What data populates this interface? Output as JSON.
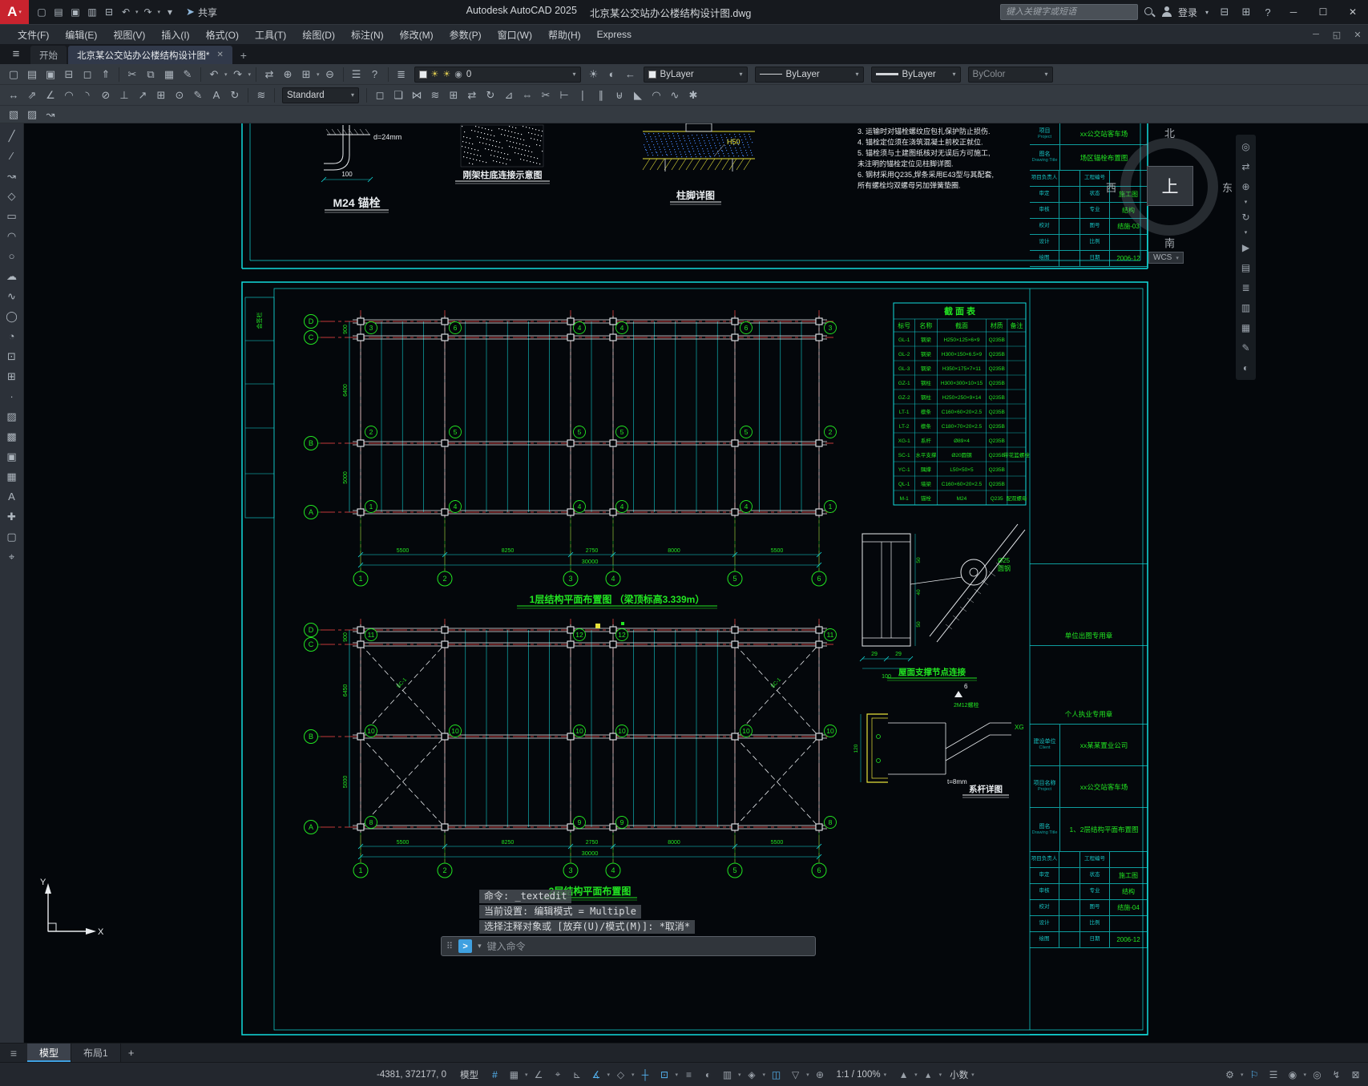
{
  "colors": {
    "accent": "#3fa0e0",
    "cad_cyan": "#12dcdc",
    "cad_red": "#c23a3a",
    "cad_green": "#22e522",
    "cad_yellow": "#e8e23a",
    "cad_white": "#e8ebee"
  },
  "titlebar": {
    "logo": "A",
    "share_label": "共享",
    "app_title": "Autodesk AutoCAD 2025",
    "doc_title": "北京某公交站办公楼结构设计图.dwg",
    "search_placeholder": "键入关键字或短语",
    "signin_label": "登录",
    "qat": [
      {
        "n": "qnew",
        "g": "▢"
      },
      {
        "n": "open",
        "g": "▤"
      },
      {
        "n": "save",
        "g": "▣"
      },
      {
        "n": "save-as",
        "g": "▥"
      },
      {
        "n": "plot",
        "g": "⊟"
      },
      {
        "n": "undo",
        "g": "↶",
        "dd": true
      },
      {
        "n": "redo",
        "g": "↷",
        "dd": true
      },
      {
        "n": "qat-customize",
        "g": "▾"
      }
    ]
  },
  "menubar": [
    "文件(F)",
    "编辑(E)",
    "视图(V)",
    "插入(I)",
    "格式(O)",
    "工具(T)",
    "绘图(D)",
    "标注(N)",
    "修改(M)",
    "参数(P)",
    "窗口(W)",
    "帮助(H)",
    "Express"
  ],
  "doc_tabs": {
    "start": "开始",
    "active": "北京某公交站办公楼结构设计图*"
  },
  "toolbar": {
    "layer_current": "0",
    "color_current": "ByLayer",
    "linetype_current": "ByLayer",
    "lineweight_current": "ByLayer",
    "plotstyle_current": "ByColor",
    "style_current": "Standard",
    "row1": [
      {
        "n": "qnew",
        "g": "▢"
      },
      {
        "n": "open",
        "g": "▤"
      },
      {
        "n": "save",
        "g": "▣"
      },
      {
        "n": "plot",
        "g": "⊟"
      },
      {
        "n": "plot-preview",
        "g": "◻"
      },
      {
        "n": "publish",
        "g": "⇑"
      },
      {
        "sep": true
      },
      {
        "n": "cut",
        "g": "✂"
      },
      {
        "n": "copy",
        "g": "⧉"
      },
      {
        "n": "paste",
        "g": "▦"
      },
      {
        "n": "match-properties",
        "g": "✎"
      },
      {
        "sep": true
      },
      {
        "n": "undo",
        "g": "↶",
        "dd": true
      },
      {
        "n": "redo",
        "g": "↷",
        "dd": true
      },
      {
        "sep": true
      },
      {
        "n": "pan",
        "g": "⇄"
      },
      {
        "n": "zoom-realtime",
        "g": "⊕"
      },
      {
        "n": "zoom-window",
        "g": "⊞",
        "dd": true
      },
      {
        "n": "zoom-previous",
        "g": "⊖"
      },
      {
        "sep": true
      },
      {
        "n": "properties-palette",
        "g": "☰"
      },
      {
        "n": "help",
        "g": "?"
      },
      {
        "sep": true
      },
      {
        "n": "layer-properties",
        "g": "≣"
      }
    ],
    "row1_mid": [
      {
        "n": "layer-off",
        "g": "☀"
      },
      {
        "n": "layer-isolate",
        "g": "◐"
      },
      {
        "n": "layer-previous",
        "g": "←"
      }
    ],
    "row2a": [
      {
        "n": "dim-linear",
        "g": "↔"
      },
      {
        "n": "dim-aligned",
        "g": "⇗"
      },
      {
        "n": "dim-angular",
        "g": "∠"
      },
      {
        "n": "dim-arc",
        "g": "◠"
      },
      {
        "n": "dim-radius",
        "g": "◝"
      },
      {
        "n": "dim-diameter",
        "g": "⊘"
      },
      {
        "n": "dim-ordinate",
        "g": "⊥"
      },
      {
        "n": "quick-leader",
        "g": "↗"
      },
      {
        "n": "tolerance",
        "g": "⊞"
      },
      {
        "n": "center-mark",
        "g": "⊙"
      },
      {
        "n": "dim-edit",
        "g": "✎"
      },
      {
        "n": "dim-text-edit",
        "g": "A"
      },
      {
        "n": "dim-update",
        "g": "↻"
      },
      {
        "sep": true
      },
      {
        "n": "dim-style",
        "g": "≋"
      },
      {
        "sep": true
      }
    ],
    "row2b": [
      {
        "sep": true
      },
      {
        "n": "erase",
        "g": "◻"
      },
      {
        "n": "copy-object",
        "g": "❏"
      },
      {
        "n": "mirror",
        "g": "⋈"
      },
      {
        "n": "offset",
        "g": "≋"
      },
      {
        "n": "array",
        "g": "⊞"
      },
      {
        "n": "move",
        "g": "⇄"
      },
      {
        "n": "rotate",
        "g": "↻"
      },
      {
        "n": "scale",
        "g": "⊿"
      },
      {
        "n": "stretch",
        "g": "⇔"
      },
      {
        "n": "trim",
        "g": "✂"
      },
      {
        "n": "extend",
        "g": "⊢"
      },
      {
        "n": "break-at-point",
        "g": "∣"
      },
      {
        "n": "break",
        "g": "∥"
      },
      {
        "n": "join",
        "g": "⊎"
      },
      {
        "n": "chamfer",
        "g": "◣"
      },
      {
        "n": "fillet",
        "g": "◠"
      },
      {
        "n": "blend-curves",
        "g": "∿"
      },
      {
        "n": "explode",
        "g": "✱"
      }
    ],
    "row3": [
      {
        "n": "draworder",
        "g": "▧"
      },
      {
        "n": "edit-hatch",
        "g": "▨"
      },
      {
        "n": "edit-polyline",
        "g": "↝"
      }
    ]
  },
  "left_toolbar": [
    {
      "n": "line",
      "g": "╱"
    },
    {
      "n": "construction-line",
      "g": "∕"
    },
    {
      "n": "polyline",
      "g": "↝"
    },
    {
      "n": "polygon",
      "g": "◇"
    },
    {
      "n": "rectangle",
      "g": "▭"
    },
    {
      "n": "arc",
      "g": "◠"
    },
    {
      "n": "circle",
      "g": "○"
    },
    {
      "n": "revision-cloud",
      "g": "☁"
    },
    {
      "n": "spline",
      "g": "∿"
    },
    {
      "n": "ellipse",
      "g": "◯"
    },
    {
      "n": "ellipse-arc",
      "g": "◔"
    },
    {
      "n": "insert-block",
      "g": "⊡"
    },
    {
      "n": "make-block",
      "g": "⊞"
    },
    {
      "n": "point",
      "g": "∙"
    },
    {
      "n": "hatch",
      "g": "▨"
    },
    {
      "n": "gradient",
      "g": "▩"
    },
    {
      "n": "region",
      "g": "▣"
    },
    {
      "n": "table",
      "g": "▦"
    },
    {
      "n": "multiline-text",
      "g": "A"
    },
    {
      "n": "add-selected",
      "g": "✚"
    },
    {
      "n": "group",
      "g": "▢"
    },
    {
      "n": "measure",
      "g": "⌖"
    }
  ],
  "navbar": [
    {
      "n": "navigation-wheel",
      "g": "◎"
    },
    {
      "n": "pan-tool",
      "g": "⇄"
    },
    {
      "n": "zoom-tool",
      "g": "⊕",
      "dd": true
    },
    {
      "n": "orbit-tool",
      "g": "↻",
      "dd": true
    },
    {
      "n": "showmotion",
      "g": "▶"
    },
    {
      "n": "properties-palette",
      "g": "▤"
    },
    {
      "n": "layers-palette",
      "g": "≣"
    },
    {
      "n": "tool-palettes",
      "g": "▥"
    },
    {
      "n": "sheet-set-manager",
      "g": "▦"
    },
    {
      "n": "markup",
      "g": "✎"
    },
    {
      "n": "render",
      "g": "◐"
    }
  ],
  "viewcube": {
    "n": "北",
    "s": "南",
    "e": "东",
    "w": "西",
    "top": "上",
    "wcs": "WCS"
  },
  "drawing": {
    "margin_label": "会签栏",
    "detail_m24": {
      "caption": "M24 锚栓",
      "d_label": "d=24mm",
      "dim": "100"
    },
    "detail_base": {
      "caption": "刚架柱底连接示意图"
    },
    "detail_foot": {
      "caption": "柱脚详图",
      "h_label": "H50"
    },
    "notes": [
      "3. 运输时对锚栓螺纹应包扎保护防止损伤.",
      "4. 锚栓定位须在浇筑混凝土前校正就位.",
      "5. 锚栓须与土建图纸核对无误后方可施工,",
      "    未注明的锚栓定位见柱脚详图.",
      "6. 钢材采用Q235,焊条采用E43型与其配套,",
      "    所有螺栓均双螺母另加弹簧垫圈."
    ],
    "titleblock_top": {
      "project_label": "项目",
      "project_sub": "Project",
      "project": "xx公交站客车场",
      "title_label": "图名",
      "title_sub": "Drawing Title",
      "title": "场区锚栓布置图",
      "rows": [
        {
          "a": "项目负责人",
          "b": "工程编号",
          "v": ""
        },
        {
          "a": "审定",
          "b": "状态",
          "v": "施工图"
        },
        {
          "a": "审核",
          "b": "专业",
          "v": "结构"
        },
        {
          "a": "校对",
          "b": "图号",
          "v": "结施-03"
        },
        {
          "a": "设计",
          "b": "比例",
          "v": ""
        },
        {
          "a": "绘图",
          "b": "日期",
          "v": "2006-12"
        }
      ]
    },
    "plan1": {
      "caption": "1层结构平面布置图 （梁顶标高3.339m）",
      "row_labels": [
        "D",
        "C",
        "B",
        "A"
      ],
      "col_labels": [
        "1",
        "2",
        "3",
        "4",
        "5",
        "6"
      ],
      "beam_rows": [
        [
          "3",
          "6",
          "4",
          "4",
          "6",
          "3"
        ],
        [
          "2",
          "5",
          "5",
          "5",
          "5",
          "2"
        ],
        [
          "1",
          "4",
          "4",
          "4",
          "4",
          "1"
        ]
      ],
      "dims": [
        "5500",
        "8250",
        "2750",
        "8000",
        "5500"
      ],
      "total": "30000",
      "left_dims": [
        "900",
        "6400",
        "5000"
      ]
    },
    "plan2": {
      "caption": "2层结构平面布置图",
      "row_labels": [
        "D",
        "C",
        "B",
        "A"
      ],
      "col_labels": [
        "1",
        "2",
        "3",
        "4",
        "5",
        "6"
      ],
      "beam_top": [
        "11",
        "12",
        "12",
        "11"
      ],
      "beam_mid": [
        "10",
        "10",
        "10",
        "10",
        "10",
        "10"
      ],
      "beam_bot": [
        "8",
        "9",
        "9",
        "8"
      ],
      "brace_label": "SC-1",
      "dims": [
        "5500",
        "8250",
        "2750",
        "8000",
        "5500"
      ],
      "total": "30000",
      "left_dims": [
        "900",
        "6450",
        "5000"
      ]
    },
    "section_table": {
      "title": "截 面 表",
      "headers": [
        "标号",
        "名称",
        "截面",
        "材质",
        "备注"
      ],
      "rows": [
        [
          "GL-1",
          "钢梁",
          "H250×125×6×9",
          "Q235B",
          ""
        ],
        [
          "GL-2",
          "钢梁",
          "H300×150×6.5×9",
          "Q235B",
          ""
        ],
        [
          "GL-3",
          "钢梁",
          "H350×175×7×11",
          "Q235B",
          ""
        ],
        [
          "GZ-1",
          "钢柱",
          "H300×300×10×15",
          "Q235B",
          ""
        ],
        [
          "GZ-2",
          "钢柱",
          "H250×250×9×14",
          "Q235B",
          ""
        ],
        [
          "LT-1",
          "檩条",
          "C160×60×20×2.5",
          "Q235B",
          ""
        ],
        [
          "LT-2",
          "檩条",
          "C180×70×20×2.5",
          "Q235B",
          ""
        ],
        [
          "XG-1",
          "系杆",
          "Ø89×4",
          "Q235B",
          ""
        ],
        [
          "SC-1",
          "水平支撑",
          "Ø20圆钢",
          "Q235B",
          "带花篮螺栓"
        ],
        [
          "YC-1",
          "隅撑",
          "L50×50×5",
          "Q235B",
          ""
        ],
        [
          "QL-1",
          "墙梁",
          "C160×60×20×2.5",
          "Q235B",
          ""
        ],
        [
          "M-1",
          "锚栓",
          "M24",
          "Q235",
          "配双螺母"
        ]
      ]
    },
    "detail_roof": {
      "caption": "屋面支撑节点连接",
      "rod_label": "Ø25",
      "rod_label2": "圆钢",
      "dims": [
        "29",
        "29"
      ],
      "dim_total": "100",
      "side_dims": [
        "50",
        "40",
        "50"
      ]
    },
    "detail_tie": {
      "caption": "系杆详图",
      "bolt_label": "2M12螺栓",
      "xg_label": "XG",
      "t_label": "t=8mm",
      "weld": "6",
      "dim": "120"
    },
    "titleblock_main": {
      "stamp1": "单位出图专用章",
      "stamp2": "个人执业专用章",
      "client_label": "建设单位",
      "client_sub": "Client",
      "client": "xx某某置业公司",
      "project_label": "项目名称",
      "project_sub": "Project",
      "project": "xx公交站客车场",
      "title_label": "图名",
      "title_sub": "Drawing Title",
      "title": "1、2层结构平面布置图",
      "rows": [
        {
          "a": "项目负责人",
          "b": "工程编号",
          "v": ""
        },
        {
          "a": "审定",
          "b": "状态",
          "v": "施工图"
        },
        {
          "a": "审核",
          "b": "专业",
          "v": "结构"
        },
        {
          "a": "校对",
          "b": "图号",
          "v": "结施-04"
        },
        {
          "a": "设计",
          "b": "比例",
          "v": ""
        },
        {
          "a": "绘图",
          "b": "日期",
          "v": "2006-12"
        }
      ]
    }
  },
  "cmdline": {
    "line1": "命令: _textedit",
    "line2": "当前设置: 编辑模式 = Multiple",
    "line3": "选择注释对象或 [放弃(U)/模式(M)]: *取消*",
    "placeholder": "键入命令"
  },
  "layout_tabs": {
    "model": "模型",
    "layout1": "布局1",
    "add": "+"
  },
  "statusbar": {
    "coords": "-4381, 372177, 0",
    "space_label": "模型",
    "scale_label": "1:1 / 100%",
    "units_label": "小数",
    "icons": [
      {
        "n": "grid-display",
        "g": "#",
        "on": true
      },
      {
        "n": "snap-mode",
        "g": "▦",
        "dd": true
      },
      {
        "n": "infer-constraints",
        "g": "∠"
      },
      {
        "n": "dynamic-input",
        "g": "⌖"
      },
      {
        "n": "ortho-mode",
        "g": "⊾"
      },
      {
        "n": "polar-tracking",
        "g": "∡",
        "on": true,
        "dd": true
      },
      {
        "n": "isometric-drafting",
        "g": "◇",
        "dd": true
      },
      {
        "n": "object-snap-tracking",
        "g": "┼",
        "on": true
      },
      {
        "n": "object-snap",
        "g": "⊡",
        "on": true,
        "dd": true
      },
      {
        "n": "lineweight-display",
        "g": "≡"
      },
      {
        "n": "transparency",
        "g": "◐"
      },
      {
        "n": "selection-cycling",
        "g": "▥",
        "dd": true
      },
      {
        "n": "3d-object-snap",
        "g": "◈",
        "dd": true
      },
      {
        "n": "dynamic-ucs",
        "g": "◫",
        "on": true
      },
      {
        "n": "selection-filtering",
        "g": "▽",
        "dd": true
      },
      {
        "n": "gizmo",
        "g": "⊕"
      }
    ],
    "icons_right": [
      {
        "n": "annotation-visibility",
        "g": "▲",
        "dd": true
      },
      {
        "n": "autoscale",
        "g": "▴",
        "dd": true
      }
    ],
    "icons_end": [
      {
        "n": "workspace-switching",
        "g": "⚙",
        "dd": true
      },
      {
        "n": "annotation-monitor",
        "g": "⚐",
        "on": true
      },
      {
        "n": "quick-properties",
        "g": "☰"
      },
      {
        "n": "lock-ui",
        "g": "◉",
        "dd": true
      },
      {
        "n": "isolate-objects",
        "g": "◎"
      },
      {
        "n": "graphics-performance",
        "g": "↯"
      },
      {
        "n": "clean-screen",
        "g": "⊠"
      }
    ]
  }
}
